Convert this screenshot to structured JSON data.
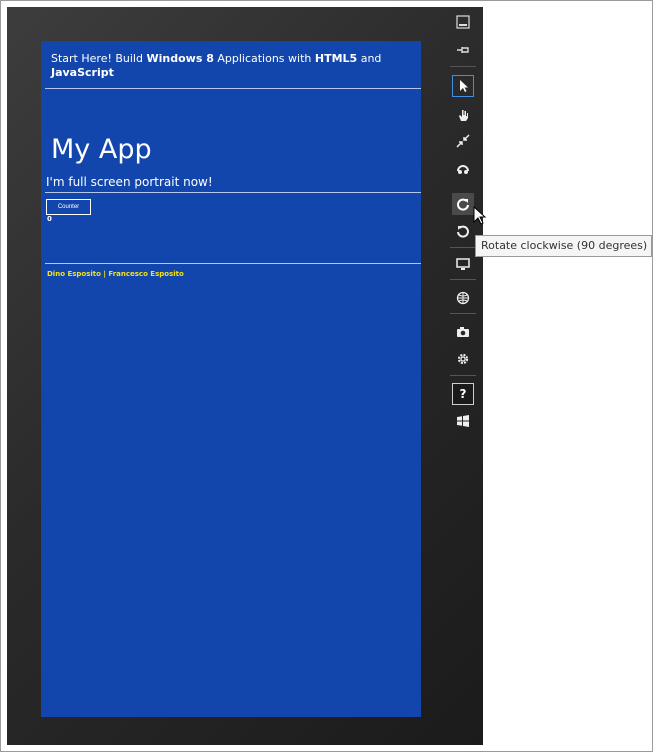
{
  "app": {
    "header": {
      "prefix": "Start Here! Build ",
      "bold1": "Windows 8",
      "middle": " Applications with ",
      "bold2": "HTML5",
      "suffix": " and",
      "bold3": "JavaScript"
    },
    "title": "My App",
    "subtitle": "I'm full screen portrait now!",
    "counter_button_label": "Counter",
    "counter_value": "0",
    "footer": "Dino Esposito | Francesco Esposito"
  },
  "simulator": {
    "toolbar": [
      {
        "name": "minimize",
        "icon": "minimize-icon"
      },
      {
        "name": "always-on-top",
        "icon": "pin-icon"
      },
      {
        "name": "mouse-mode",
        "icon": "pointer-icon",
        "selected": true
      },
      {
        "name": "basic-touch-mode",
        "icon": "hand-icon"
      },
      {
        "name": "pinch-zoom-touch-mode",
        "icon": "pinch-icon"
      },
      {
        "name": "rotation-touch-mode",
        "icon": "rotation-touch-icon"
      },
      {
        "name": "rotate-clockwise",
        "icon": "rotate-clockwise-icon",
        "hover": true
      },
      {
        "name": "rotate-counterclockwise",
        "icon": "rotate-counterclockwise-icon"
      },
      {
        "name": "change-resolution",
        "icon": "monitor-icon"
      },
      {
        "name": "set-location",
        "icon": "globe-icon"
      },
      {
        "name": "copy-screenshot",
        "icon": "camera-icon"
      },
      {
        "name": "screenshot-settings",
        "icon": "gear-icon"
      },
      {
        "name": "help",
        "icon": "help-icon",
        "glyph": "?"
      },
      {
        "name": "start",
        "icon": "windows-logo-icon"
      }
    ],
    "tooltip": "Rotate clockwise (90 degrees)"
  },
  "colors": {
    "app_background": "#1346ad",
    "footer_text": "#f3e217",
    "toolbar_selected_border": "#3f8fe6"
  }
}
